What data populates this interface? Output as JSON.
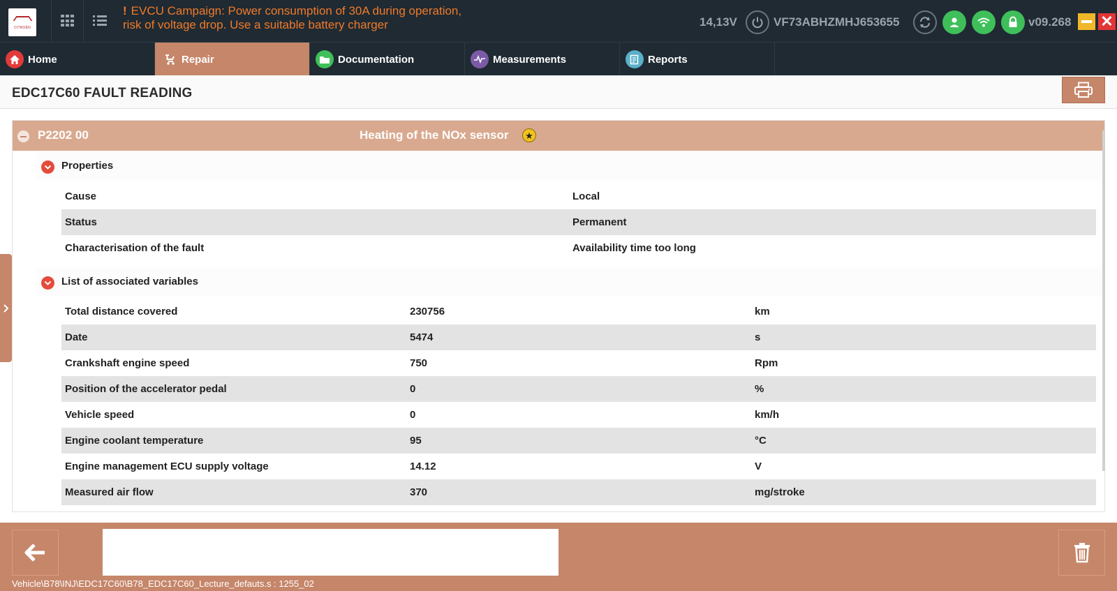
{
  "alert": {
    "line1": "EVCU Campaign: Power consumption of 30A during operation,",
    "line2": "risk of voltage drop. Use a suitable battery charger"
  },
  "status": {
    "voltage": "14,13V",
    "vin": "VF73ABHZMHJ653655",
    "version": "v09.268"
  },
  "logo": {
    "brand": "CITROËN"
  },
  "nav": {
    "tabs": [
      {
        "label": "Home",
        "icon": "home-icon",
        "color": "#e23a3a"
      },
      {
        "label": "Repair",
        "icon": "repair-icon",
        "color": "#c6866a"
      },
      {
        "label": "Documentation",
        "icon": "folder-icon",
        "color": "#3fbf5a"
      },
      {
        "label": "Measurements",
        "icon": "waveform-icon",
        "color": "#7c5aa6"
      },
      {
        "label": "Reports",
        "icon": "report-icon",
        "color": "#5ab0c8"
      }
    ]
  },
  "page": {
    "title": "EDC17C60 FAULT READING"
  },
  "fault": {
    "code": "P2202 00",
    "description": "Heating of the NOx sensor",
    "badge": "★"
  },
  "properties": {
    "title": "Properties",
    "rows": [
      {
        "name": "Cause",
        "value": "Local"
      },
      {
        "name": "Status",
        "value": "Permanent"
      },
      {
        "name": "Characterisation of the fault",
        "value": "Availability time too long"
      }
    ]
  },
  "variables": {
    "title": "List of associated variables",
    "rows": [
      {
        "name": "Total distance covered",
        "value": "230756",
        "unit": "km"
      },
      {
        "name": "Date",
        "value": "5474",
        "unit": "s"
      },
      {
        "name": "Crankshaft engine speed",
        "value": "750",
        "unit": "Rpm"
      },
      {
        "name": "Position of the accelerator pedal",
        "value": "0",
        "unit": "%"
      },
      {
        "name": "Vehicle speed",
        "value": "0",
        "unit": "km/h"
      },
      {
        "name": "Engine coolant temperature",
        "value": "95",
        "unit": "°C"
      },
      {
        "name": "Engine management ECU supply voltage",
        "value": "14.12",
        "unit": "V"
      },
      {
        "name": "Measured air flow",
        "value": "370",
        "unit": "mg/stroke"
      }
    ]
  },
  "footer": {
    "path": "Vehicle\\B78\\INJ\\EDC17C60\\B78_EDC17C60_Lecture_defauts.s : 1255_02",
    "input_value": ""
  },
  "colors": {
    "accent": "#c6866a",
    "topbar": "#1f2a33",
    "alert": "#f07a2a",
    "fault_header": "#d9a98f",
    "status_green": "#3fbf5a"
  }
}
